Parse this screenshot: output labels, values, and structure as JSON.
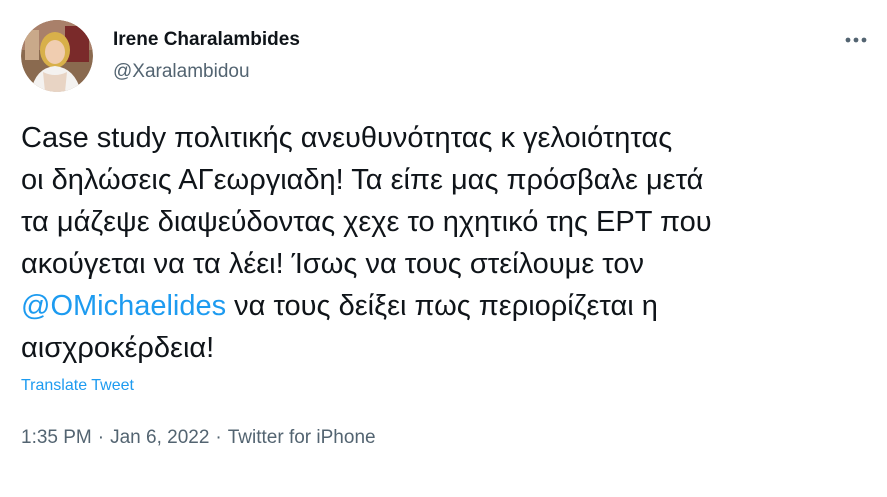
{
  "author": {
    "name": "Irene Charalambides",
    "handle": "@Xaralambidou"
  },
  "icons": {
    "more": "more-horizontal-icon",
    "avatar": "profile-photo"
  },
  "tweet": {
    "line1": "Case study πολιτικής ανευθυνότητας κ γελοιότητας",
    "line2": "οι δηλώσεις ΑΓεωργιαδη! Τα είπε μας πρόσβαλε μετά",
    "line3": "τα μάζεψε διαψεύδοντας χεχε το ηχητικό της ΕΡΤ που",
    "line4": "ακούγεται να τα λέει! Ίσως να τους στείλουμε τον",
    "line5_mention": "@OMichaelides",
    "line5_rest": " να τους δείξει πως περιορίζεται η",
    "line6": "αισχροκέρδεια!"
  },
  "translate_label": "Translate Tweet",
  "meta": {
    "time": "1:35 PM",
    "separator": "·",
    "date": "Jan 6, 2022",
    "source": "Twitter for iPhone"
  },
  "colors": {
    "link": "#1d9bf0",
    "secondary_text": "#536471",
    "primary_text": "#0f1419"
  }
}
